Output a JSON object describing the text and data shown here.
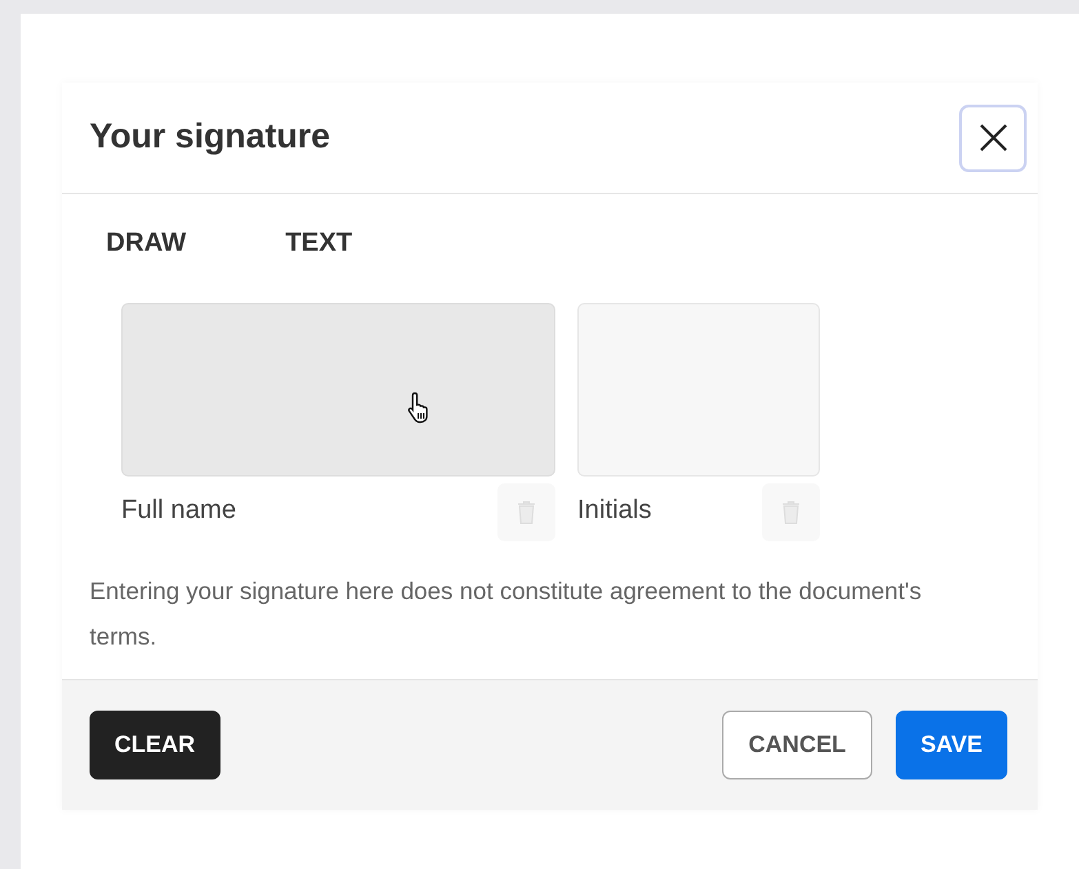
{
  "dialog": {
    "title": "Your signature"
  },
  "tabs": [
    {
      "label": "DRAW"
    },
    {
      "label": "TEXT"
    }
  ],
  "pads": [
    {
      "label": "Full name",
      "hovered": true
    },
    {
      "label": "Initials",
      "hovered": false
    }
  ],
  "note": "Entering your signature here does not constitute agreement to the document's terms.",
  "buttons": [
    {
      "label": "CLEAR",
      "kind": "dark"
    },
    {
      "label": "CANCEL",
      "kind": "outline"
    },
    {
      "label": "SAVE",
      "kind": "primary"
    }
  ]
}
